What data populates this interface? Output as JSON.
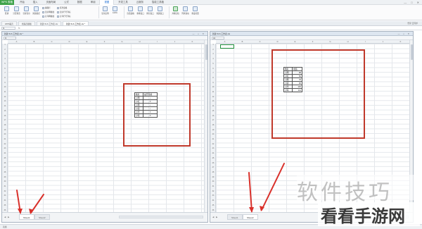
{
  "app": {
    "logo_label": "WPS 表格"
  },
  "menu_tabs": [
    "开始",
    "插入",
    "页面布局",
    "公式",
    "数据",
    "审阅",
    "视图",
    "开发工具",
    "云服务",
    "智能工具箱"
  ],
  "active_menu_index": 6,
  "window_controls": [
    "—",
    "□",
    "✕"
  ],
  "ribbon": {
    "group1": [
      {
        "label": "普通",
        "icon": "normal-view-icon"
      },
      {
        "label": "分页预览",
        "icon": "page-break-icon"
      },
      {
        "label": "全屏显示",
        "icon": "fullscreen-icon"
      },
      {
        "label": "阅读模式",
        "icon": "reading-mode-icon"
      }
    ],
    "checks1": [
      "编辑栏",
      "显示网格线",
      "打印网格线"
    ],
    "checks2": [
      "任务窗格",
      "显示行号列标",
      "打印行号列标"
    ],
    "group2": [
      {
        "label": "显示比例",
        "icon": "zoom-icon"
      },
      {
        "label": "100%",
        "icon": "zoom-100-icon"
      }
    ],
    "group3": [
      {
        "label": "冻结窗格",
        "icon": "freeze-icon"
      },
      {
        "label": "重排窗口",
        "icon": "arrange-icon"
      },
      {
        "label": "拆分窗口",
        "icon": "split-icon"
      },
      {
        "label": "新建窗口",
        "icon": "new-window-icon"
      }
    ],
    "group4": [
      {
        "label": "并排比较",
        "icon": "side-by-side-icon",
        "active": true
      },
      {
        "label": "同步滚动",
        "icon": "sync-scroll-icon"
      },
      {
        "label": "重设位置",
        "icon": "reset-position-icon"
      }
    ]
  },
  "doc_tabs": [
    {
      "label": "WPS稻壳",
      "active": false
    },
    {
      "label": "找稻壳模板",
      "active": false
    },
    {
      "label": "新建 XLS 工作表.xls",
      "active": false
    },
    {
      "label": "新建 XLS 工作表.xls *",
      "active": true
    }
  ],
  "doc_tabs_right": "登录 云同步",
  "formula_bar": {
    "name_box": "I1",
    "fx": "fx"
  },
  "left_pane": {
    "title": "新建 XLS 工作表.xls *",
    "name_box": "I1",
    "sheets": [
      "Sheet1",
      "Sheet2"
    ],
    "table": {
      "headers": [
        "姓名",
        "是否完成"
      ],
      "rows": [
        [
          "小明",
          "✓"
        ],
        [
          "小红",
          "✕"
        ],
        [
          "小刚",
          "✓"
        ],
        [
          "小丽",
          "✓"
        ],
        [
          "小华",
          "✕"
        ],
        [
          "小军",
          "✕"
        ]
      ]
    }
  },
  "right_pane": {
    "title": "新建 XLS 工作表.xls",
    "name_box": "A1",
    "sheets": [
      "Sheet1",
      "Sheet2"
    ],
    "table": {
      "headers": [
        "姓名",
        "成绩"
      ],
      "rows": [
        [
          "小明",
          "98"
        ],
        [
          "小红",
          "56"
        ],
        [
          "小刚",
          "78"
        ],
        [
          "小丽",
          "96"
        ],
        [
          "小华",
          "115"
        ],
        [
          "小军",
          "111"
        ]
      ]
    }
  },
  "columns": [
    "A",
    "B",
    "C",
    "D",
    "E",
    "F",
    "G",
    "H",
    "I",
    "J",
    "K"
  ],
  "rows": [
    "1",
    "2",
    "3",
    "4",
    "5",
    "6",
    "7",
    "8",
    "9",
    "10",
    "11",
    "12",
    "13",
    "14",
    "15",
    "16",
    "17",
    "18",
    "19",
    "20",
    "21",
    "22",
    "23",
    "24",
    "25",
    "26",
    "27",
    "28",
    "29",
    "30",
    "31",
    "32",
    "33",
    "34",
    "35",
    "36"
  ],
  "status": "就绪",
  "watermark": {
    "line1": "软件技巧",
    "line2": "看看手游网"
  },
  "colors": {
    "accent": "#3fa34a",
    "highlight": "#c0392b",
    "link": "#1d6fd6"
  }
}
